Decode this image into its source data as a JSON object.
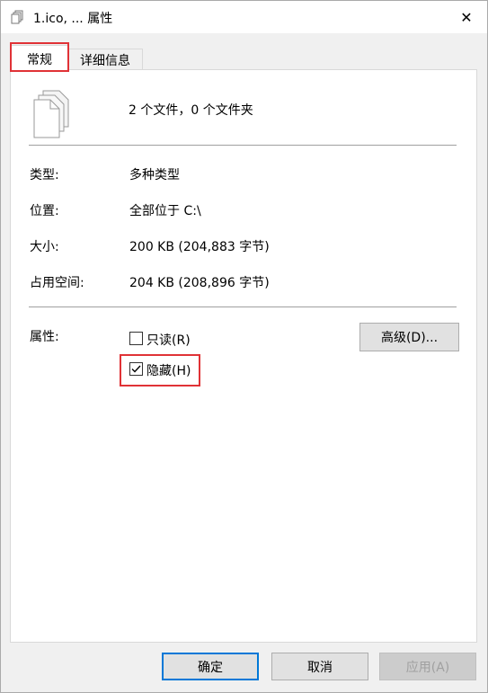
{
  "window": {
    "title": "1.ico, ... 属性",
    "close_label": "✕"
  },
  "tabs": [
    {
      "label": "常规",
      "active": true
    },
    {
      "label": "详细信息",
      "active": false
    }
  ],
  "summary": {
    "text": "2 个文件，0 个文件夹"
  },
  "info": {
    "type_label": "类型:",
    "type_value": "多种类型",
    "location_label": "位置:",
    "location_value": "全部位于 C:\\",
    "size_label": "大小:",
    "size_value": "200 KB (204,883 字节)",
    "disk_label": "占用空间:",
    "disk_value": "204 KB (208,896 字节)"
  },
  "attributes": {
    "label": "属性:",
    "readonly_label": "只读(R)",
    "readonly_checked": false,
    "hidden_label": "隐藏(H)",
    "hidden_checked": true,
    "advanced_button": "高级(D)..."
  },
  "buttons": {
    "ok": "确定",
    "cancel": "取消",
    "apply": "应用(A)"
  },
  "colors": {
    "highlight": "#e03236",
    "focus": "#0078d7"
  }
}
